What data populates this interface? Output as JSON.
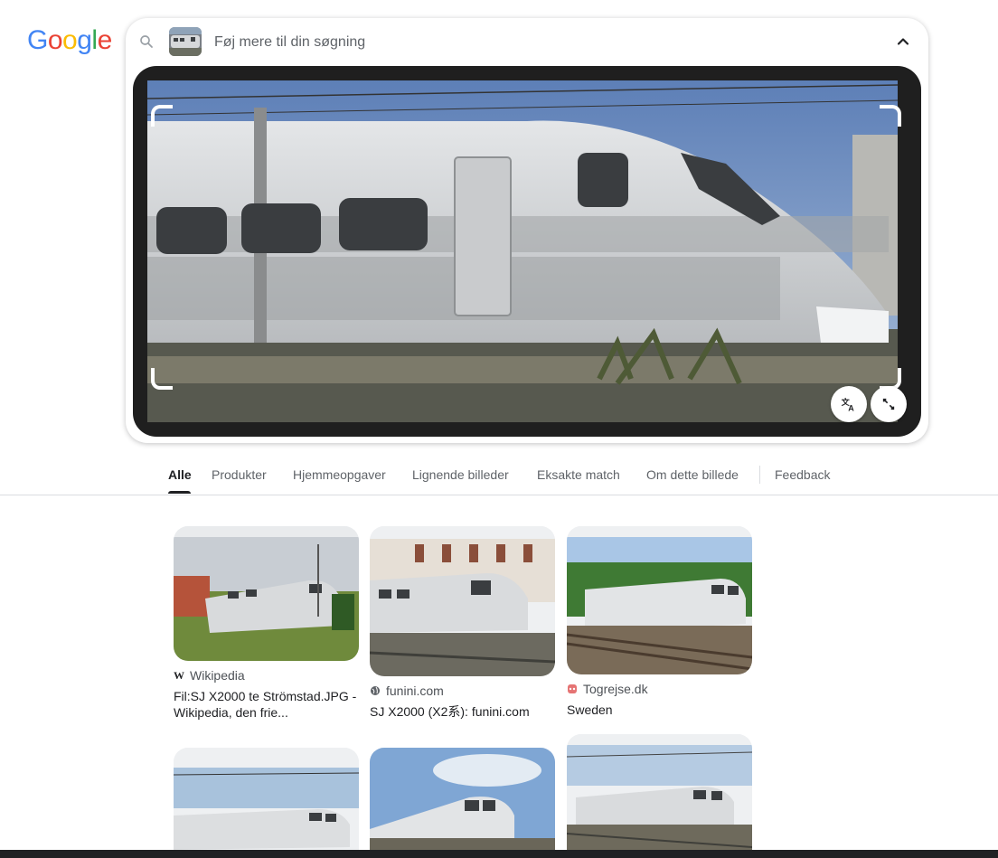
{
  "logo": {
    "letters": [
      "G",
      "o",
      "o",
      "g",
      "l",
      "e"
    ],
    "colors": [
      "#4285F4",
      "#EA4335",
      "#FBBC05",
      "#4285F4",
      "#34A853",
      "#EA4335"
    ]
  },
  "search": {
    "placeholder": "Føj mere til din søgning",
    "value": ""
  },
  "icons": {
    "search": "search-icon",
    "chevron": "chevron-up-icon",
    "translate": "translate-icon",
    "expand": "expand-icon"
  },
  "tabs": [
    {
      "label": "Alle",
      "active": true
    },
    {
      "label": "Produkter"
    },
    {
      "label": "Hjemmeopgaver"
    },
    {
      "label": "Lignende billeder"
    },
    {
      "label": "Eksakte match"
    },
    {
      "label": "Om dette billede"
    },
    {
      "label": "Feedback"
    }
  ],
  "results": [
    {
      "source": "Wikipedia",
      "title": "Fil:SJ X2000 te Strömstad.JPG - Wikipedia, den frie..."
    },
    {
      "source": "funini.com",
      "title": "SJ X2000 (X2系): funini.com"
    },
    {
      "source": "Togrejse.dk",
      "title": "Sweden"
    },
    {
      "source": "",
      "title": ""
    },
    {
      "source": "",
      "title": ""
    },
    {
      "source": "",
      "title": ""
    }
  ],
  "colors": {
    "accent": "#202124",
    "secondary_text": "#5f6368",
    "divider": "#dadce0",
    "lens_frame": "#1f1f1f"
  }
}
